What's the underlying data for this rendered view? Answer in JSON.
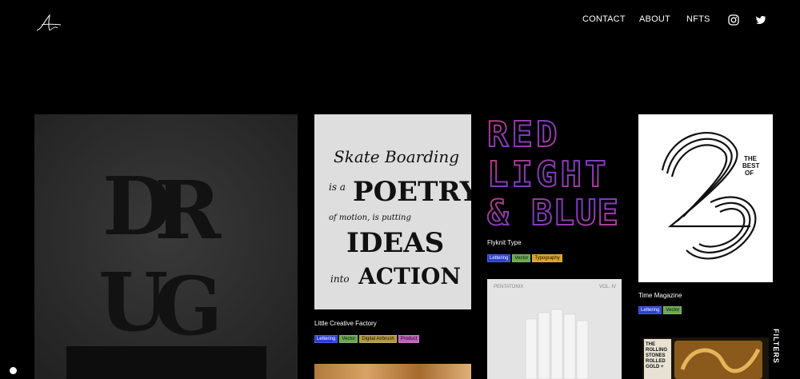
{
  "nav": {
    "contact": "CONTACT",
    "about": "ABOUT",
    "nfts": "NFTS"
  },
  "social": {
    "instagram_icon": "instagram-icon",
    "twitter_icon": "twitter-icon"
  },
  "tags_colors": {
    "lettering": "#2b3fd6",
    "vector": "#6aa84f",
    "typography": "#d9a520",
    "digital_airbrush": "#b49a3f",
    "product": "#c060c0"
  },
  "projects": [
    {
      "title": "",
      "image_text": [
        "D",
        "R",
        "U",
        "G"
      ]
    },
    {
      "title": "Little Creative Factory",
      "image_text": [
        "Skate Boarding",
        "is a",
        "POETRY",
        "of motion, is putting",
        "IDEAS",
        "into",
        "ACTION"
      ],
      "tags": [
        "Lettering",
        "Vector",
        "Digital Airbrush",
        "Product"
      ]
    },
    {
      "title": "Flyknit Type",
      "image_text": [
        "RED",
        "LIGHT",
        "& BLUE"
      ],
      "tags": [
        "Lettering",
        "Vector",
        "Typography"
      ]
    },
    {
      "title": "",
      "image_text": [
        "PENTATONIX",
        "VOL. IV"
      ]
    },
    {
      "title": "Time Magazine",
      "image_text": [
        "THE",
        "BEST",
        "OF",
        "23"
      ],
      "tags": [
        "Lettering",
        "Vector"
      ]
    },
    {
      "title": "",
      "image_text": [
        "THE",
        "ROLLING",
        "STONES",
        "ROLLED",
        "GOLD +"
      ]
    }
  ],
  "filters": "FILTERS"
}
